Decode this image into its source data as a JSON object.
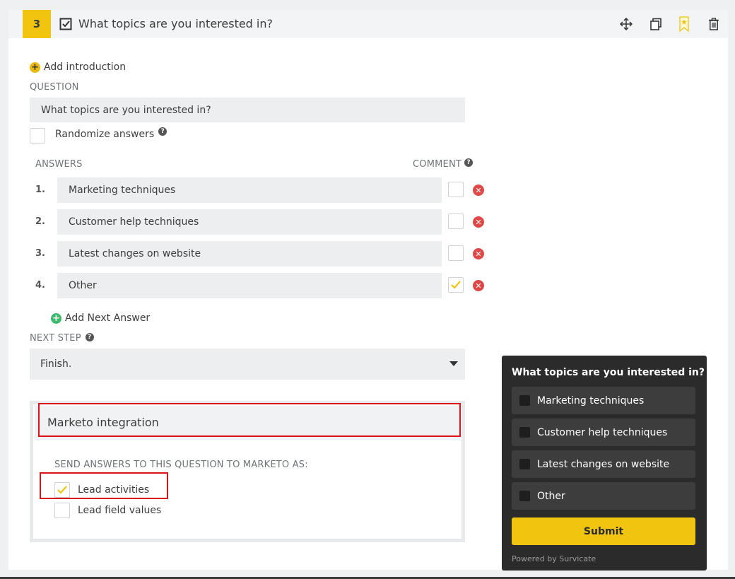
{
  "header": {
    "number": "3",
    "title": "What topics are you interested in?"
  },
  "add_introduction": "Add introduction",
  "question": {
    "label": "QUESTION",
    "value": "What topics are you interested in?"
  },
  "randomize_label": "Randomize answers",
  "answers": {
    "label": "ANSWERS",
    "comment_label": "COMMENT",
    "items": [
      {
        "num": "1.",
        "text": "Marketing techniques",
        "comment": false
      },
      {
        "num": "2.",
        "text": "Customer help techniques",
        "comment": false
      },
      {
        "num": "3.",
        "text": "Latest changes on website",
        "comment": false
      },
      {
        "num": "4.",
        "text": "Other",
        "comment": true
      }
    ],
    "add_next": "Add Next Answer"
  },
  "next_step": {
    "label": "NEXT STEP",
    "value": "Finish."
  },
  "marketo": {
    "title": "Marketo integration",
    "send_label": "SEND ANSWERS TO THIS QUESTION TO MARKETO AS:",
    "options": [
      {
        "label": "Lead activities",
        "checked": true
      },
      {
        "label": "Lead field values",
        "checked": false
      }
    ]
  },
  "preview": {
    "title": "What topics are you interested in?",
    "options": [
      "Marketing techniques",
      "Customer help techniques",
      "Latest changes on website",
      "Other"
    ],
    "submit": "Submit",
    "powered": "Powered by Survicate"
  },
  "colors": {
    "accent": "#f1c40f",
    "danger": "#e04848",
    "highlight": "#d9141b",
    "add_green": "#3dbb6c"
  }
}
